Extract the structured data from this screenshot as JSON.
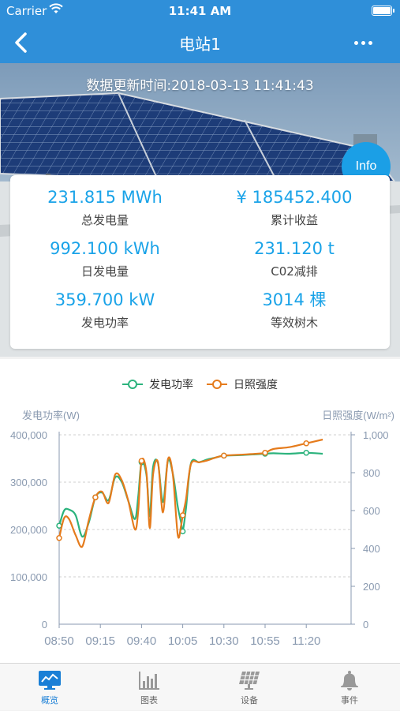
{
  "status_bar": {
    "carrier": "Carrier",
    "time": "11:41 AM"
  },
  "nav": {
    "title": "电站1"
  },
  "banner": {
    "update_label": "数据更新时间:",
    "update_time": "2018-03-13 11:41:43",
    "info_label": "Info"
  },
  "stats": [
    {
      "value": "231.815 MWh",
      "label": "总发电量"
    },
    {
      "value": "¥ 185452.400",
      "label": "累计收益"
    },
    {
      "value": "992.100 kWh",
      "label": "日发电量"
    },
    {
      "value": "231.120 t",
      "label": "C02减排"
    },
    {
      "value": "359.700 kW",
      "label": "发电功率"
    },
    {
      "value": "3014 棵",
      "label": "等效树木"
    }
  ],
  "colors": {
    "accent": "#2f8fd9",
    "value_blue": "#1aa3e8",
    "power_green": "#2cb37d",
    "irradiance_orange": "#e57b1c"
  },
  "tabs": [
    {
      "label": "概览",
      "icon": "monitor-icon",
      "active": true
    },
    {
      "label": "图表",
      "icon": "bar-chart-icon",
      "active": false
    },
    {
      "label": "设备",
      "icon": "solar-panel-icon",
      "active": false
    },
    {
      "label": "事件",
      "icon": "bell-icon",
      "active": false
    }
  ],
  "chart_data": {
    "type": "line",
    "legend": [
      "发电功率",
      "日照强度"
    ],
    "legend_position": "top-center",
    "ylabel_left": "发电功率(W)",
    "ylabel_right": "日照强度(W/m²)",
    "ylim_left": [
      0,
      400000
    ],
    "ylim_right": [
      0,
      1000
    ],
    "yticks_left": [
      "0",
      "100,000",
      "200,000",
      "300,000",
      "400,000"
    ],
    "yticks_right": [
      "0",
      "200",
      "400",
      "600",
      "800",
      "1,000"
    ],
    "xticks": [
      "08:50",
      "09:15",
      "09:40",
      "10:05",
      "10:30",
      "10:55",
      "11:20"
    ],
    "grid": true,
    "series": [
      {
        "name": "发电功率",
        "axis": "left",
        "x": [
          "08:50",
          "08:53",
          "08:56",
          "09:00",
          "09:04",
          "09:08",
          "09:12",
          "09:16",
          "09:20",
          "09:24",
          "09:28",
          "09:32",
          "09:36",
          "09:38",
          "09:40",
          "09:43",
          "09:45",
          "09:47",
          "09:50",
          "09:53",
          "09:56",
          "09:59",
          "10:02",
          "10:04",
          "10:05",
          "10:07",
          "10:10",
          "10:15",
          "10:20",
          "10:25",
          "10:30",
          "10:40",
          "10:50",
          "10:55",
          "11:00",
          "11:10",
          "11:20",
          "11:30"
        ],
        "values": [
          208000,
          240000,
          242000,
          230000,
          185000,
          215000,
          268000,
          278000,
          262000,
          310000,
          300000,
          260000,
          222000,
          270000,
          342000,
          315000,
          228000,
          332000,
          340000,
          258000,
          345000,
          318000,
          248000,
          215000,
          196000,
          245000,
          340000,
          342000,
          348000,
          352000,
          356000,
          357000,
          359000,
          360000,
          361000,
          360000,
          362000,
          360000
        ]
      },
      {
        "name": "日照强度",
        "axis": "right",
        "x": [
          "08:50",
          "08:53",
          "08:56",
          "09:00",
          "09:04",
          "09:08",
          "09:12",
          "09:16",
          "09:20",
          "09:24",
          "09:28",
          "09:32",
          "09:36",
          "09:38",
          "09:40",
          "09:43",
          "09:45",
          "09:47",
          "09:50",
          "09:53",
          "09:56",
          "09:59",
          "10:02",
          "10:04",
          "10:05",
          "10:07",
          "10:10",
          "10:15",
          "10:20",
          "10:25",
          "10:30",
          "10:40",
          "10:50",
          "10:55",
          "11:00",
          "11:10",
          "11:20",
          "11:30"
        ],
        "values": [
          455,
          560,
          555,
          470,
          410,
          550,
          670,
          700,
          640,
          790,
          760,
          650,
          500,
          600,
          862,
          800,
          508,
          790,
          855,
          590,
          870,
          790,
          470,
          520,
          575,
          660,
          845,
          855,
          865,
          880,
          890,
          895,
          900,
          905,
          925,
          935,
          955,
          975
        ]
      }
    ]
  }
}
